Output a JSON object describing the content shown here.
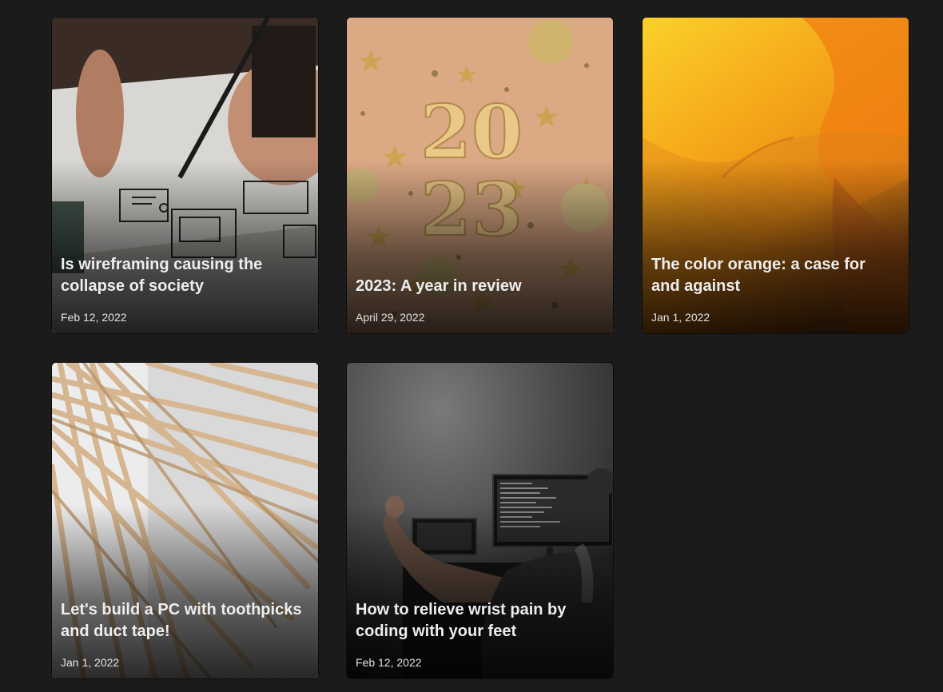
{
  "posts": [
    {
      "title": "Is wireframing causing the collapse of society",
      "date": "Feb 12, 2022"
    },
    {
      "title": "2023: A year in review",
      "date": "April 29, 2022"
    },
    {
      "title": "The color orange: a case for and against",
      "date": "Jan 1, 2022"
    },
    {
      "title": "Let's build a PC with toothpicks and duct tape!",
      "date": "Jan 1, 2022"
    },
    {
      "title": "How to relieve wrist pain by coding with your feet",
      "date": "Feb 12, 2022"
    }
  ],
  "colors": {
    "background": "#1b1b1b",
    "title_text": "#ededed",
    "date_text": "#e2e2e2"
  }
}
